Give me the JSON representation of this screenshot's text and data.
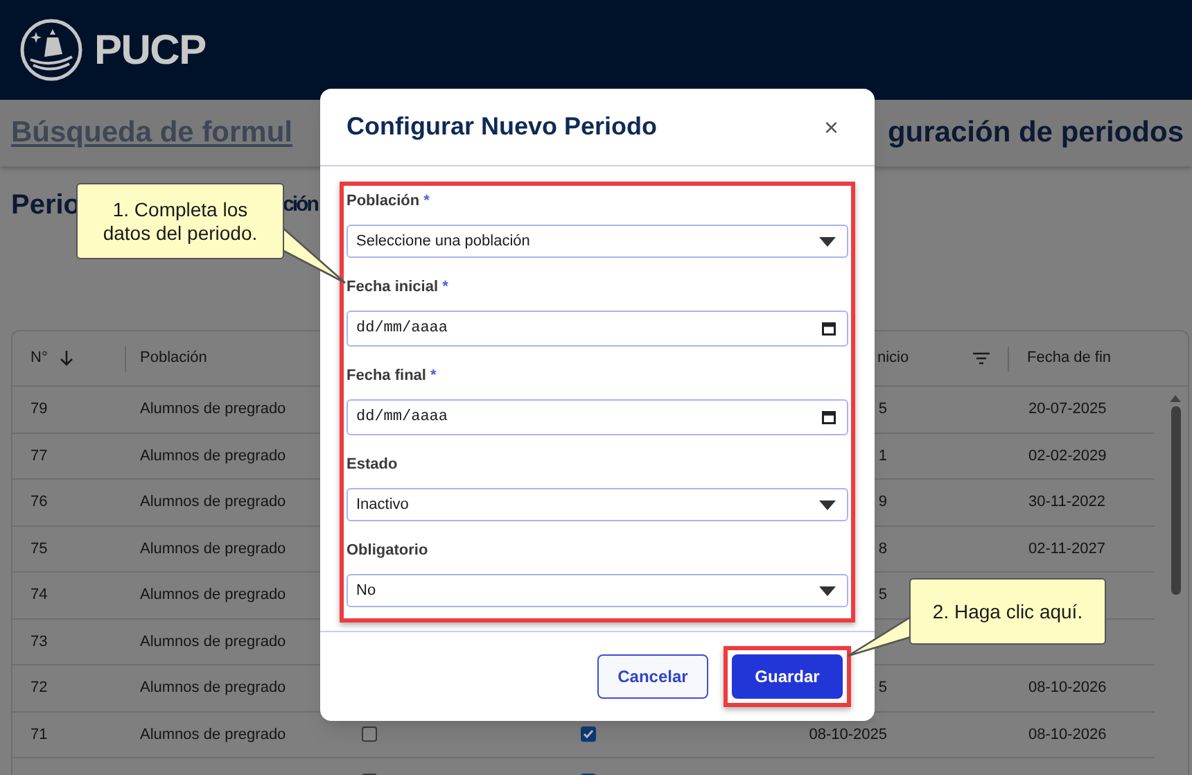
{
  "header": {
    "logo_text": "PUCP"
  },
  "page_bar": {
    "nav_link": "Búsqueda de formul",
    "page_title": "guración de periodos"
  },
  "section_title_parts": [
    "Perio",
    "ción"
  ],
  "table": {
    "columns": [
      {
        "label": "N°",
        "kind": "sort"
      },
      {
        "label": "Población",
        "kind": "plain"
      },
      {
        "label": "nicio",
        "kind": "filter"
      },
      {
        "label": "Fecha de fin",
        "kind": "plain"
      }
    ],
    "rows": [
      {
        "number": "79",
        "population": "Alumnos de pregrado",
        "start": "5",
        "end": "20-07-2025"
      },
      {
        "number": "77",
        "population": "Alumnos de pregrado",
        "start": "1",
        "end": "02-02-2029"
      },
      {
        "number": "76",
        "population": "Alumnos de pregrado",
        "start": "9",
        "end": "30-11-2022"
      },
      {
        "number": "75",
        "population": "Alumnos de pregrado",
        "start": "8",
        "end": "02-11-2027"
      },
      {
        "number": "74",
        "population": "Alumnos de pregrado",
        "start": "5"
      },
      {
        "number": "73",
        "population": "Alumnos de pregrado"
      },
      {
        "number": "72",
        "population": "Alumnos de pregrado",
        "start": "5",
        "end": "08-10-2026"
      },
      {
        "number": "71",
        "population": "Alumnos de pregrado",
        "check_1": false,
        "check_2": true,
        "start": "08-10-2025",
        "end": "08-10-2026"
      },
      {
        "check_1": false,
        "check_2": true
      }
    ]
  },
  "modal": {
    "title": "Configurar Nuevo Periodo",
    "close": "×",
    "form_highlighted": true,
    "fields": [
      {
        "kind": "select",
        "label": "Población",
        "required_mark": "*",
        "value": "Seleccione una población"
      },
      {
        "kind": "date",
        "label": "Fecha inicial",
        "required_mark": "*",
        "placeholder": "dd/mm/aaaa"
      },
      {
        "kind": "date",
        "label": "Fecha final",
        "required_mark": "*",
        "placeholder": "dd/mm/aaaa"
      },
      {
        "kind": "select",
        "label": "Estado",
        "value": "Inactivo"
      },
      {
        "kind": "select",
        "label": "Obligatorio",
        "value": "No"
      }
    ],
    "buttons": [
      {
        "label": "Cancelar",
        "kind": "secondary",
        "highlighted": false
      },
      {
        "label": "Guardar",
        "kind": "primary",
        "highlighted": true
      }
    ]
  },
  "callouts": [
    {
      "text": "1. Completa los datos del periodo."
    },
    {
      "text": "2. Haga clic aquí."
    }
  ]
}
